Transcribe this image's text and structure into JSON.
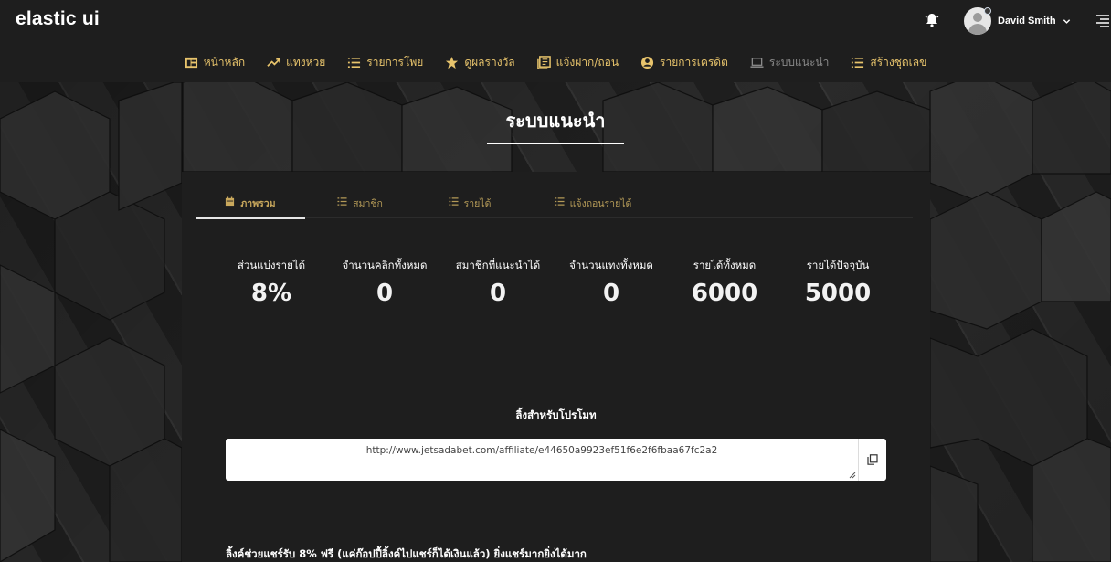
{
  "app": {
    "brand": "elastic ui",
    "user_name": "David Smith"
  },
  "icons": {
    "bell": "bell-icon",
    "hamburger": "hamburger-icon",
    "chevron": "chevron-down-icon",
    "copy": "copy-icon"
  },
  "colors": {
    "accent": "#e8c46c",
    "nav_inactive": "#8a8a8a",
    "background": "#1e1e1e"
  },
  "nav": {
    "items": [
      {
        "label": "หน้าหลัก",
        "icon": "dashboard-icon"
      },
      {
        "label": "แทงหวย",
        "icon": "trend-icon"
      },
      {
        "label": "รายการโพย",
        "icon": "list-icon"
      },
      {
        "label": "ดูผลรางวัล",
        "icon": "star-icon"
      },
      {
        "label": "แจ้งฝาก/ถอน",
        "icon": "book-icon"
      },
      {
        "label": "รายการเครดิต",
        "icon": "user-circle-icon"
      },
      {
        "label": "ระบบแนะนำ",
        "icon": "laptop-icon"
      },
      {
        "label": "สร้างชุดเลข",
        "icon": "list-icon"
      }
    ]
  },
  "page": {
    "title": "ระบบแนะนำ"
  },
  "tabs": [
    {
      "label": "ภาพรวม",
      "icon": "calendar-icon"
    },
    {
      "label": "สมาชิก",
      "icon": "list-icon"
    },
    {
      "label": "รายได้",
      "icon": "list-icon"
    },
    {
      "label": "แจ้งถอนรายได้",
      "icon": "list-icon"
    }
  ],
  "stats": [
    {
      "label": "ส่วนแบ่งรายได้",
      "value": "8%"
    },
    {
      "label": "จำนวนคลิกทั้งหมด",
      "value": "0"
    },
    {
      "label": "สมาชิกที่แนะนำได้",
      "value": "0"
    },
    {
      "label": "จำนวนแทงทั้งหมด",
      "value": "0"
    },
    {
      "label": "รายได้ทั้งหมด",
      "value": "6000"
    },
    {
      "label": "รายได้ปัจจุบัน",
      "value": "5000"
    }
  ],
  "promo": {
    "label": "ลิ้งสำหรับโปรโมท",
    "link": "http://www.jetsadabet.com/affiliate/e44650a9923ef51f6e2f6fbaa67fc2a2"
  },
  "footer": {
    "text": "ลิ้งค์ช่วยแชร์รับ 8% ฟรี (แค่ก๊อปปี้ลิ้งค์ไปแชร์ก็ได้เงินแล้ว) ยิ่งแชร์มากยิ่งได้มาก"
  }
}
